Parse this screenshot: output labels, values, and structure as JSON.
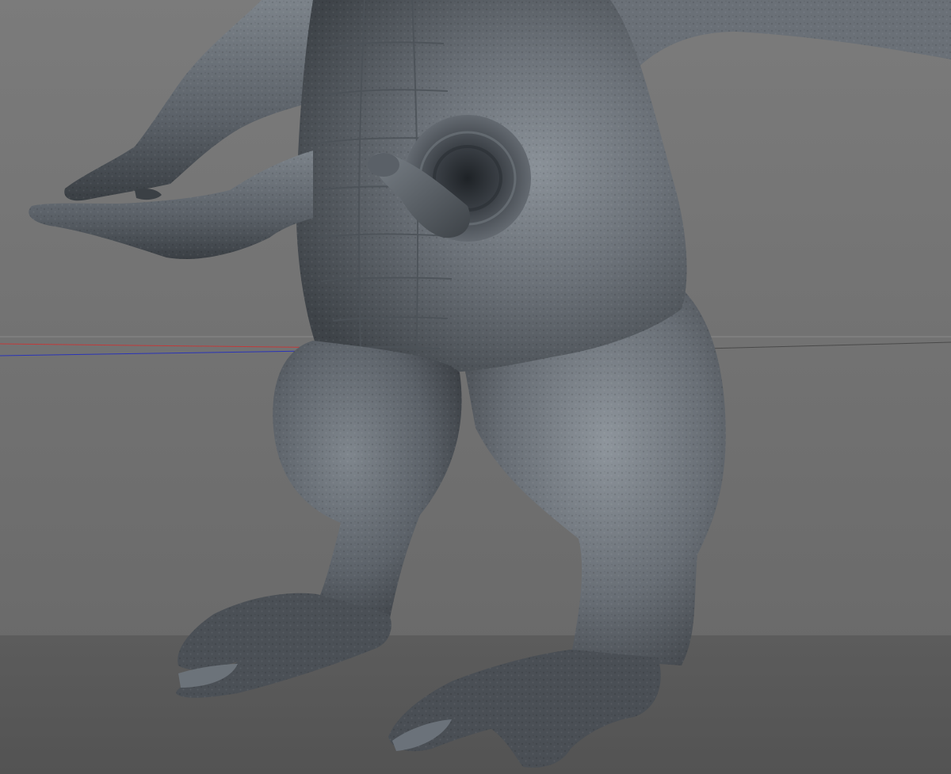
{
  "viewport": {
    "background": {
      "upper": "#7a7a7a",
      "lower": "#6a6a6a",
      "floor": "#5a5a5a"
    },
    "axes": {
      "x_axis_color": "#c23a3a",
      "z_axis_color": "#2a34b8",
      "horizon_color": "#8c8c8c"
    },
    "model": {
      "shading": "sculpt-clay",
      "base_color": "#5d636a",
      "highlight_color": "#8f969d",
      "shadow_color": "#2c3035"
    }
  }
}
